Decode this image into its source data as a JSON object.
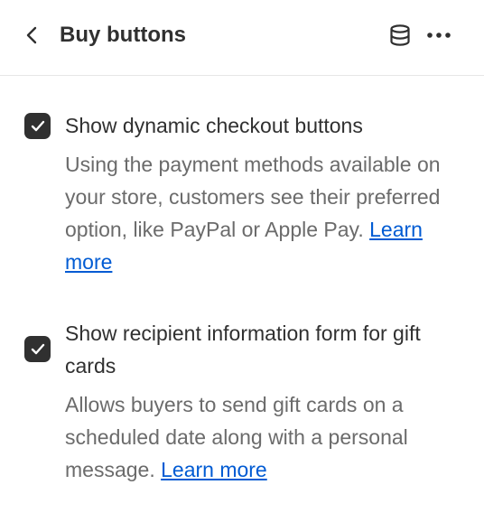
{
  "header": {
    "title": "Buy buttons",
    "back_icon": "chevron-left-icon",
    "database_icon": "database-icon",
    "more_icon": "ellipsis-horizontal-icon"
  },
  "settings": [
    {
      "checked": true,
      "label": "Show dynamic checkout buttons",
      "description": "Using the payment methods available on your store, customers see their preferred option, like PayPal or Apple Pay.",
      "link": "Learn more"
    },
    {
      "checked": true,
      "label": "Show recipient information form for gift cards",
      "description": "Allows buyers to send gift cards on a scheduled date along with a personal message.",
      "link": "Learn more"
    }
  ],
  "colors": {
    "text": "#303030",
    "muted": "#6b6b6b",
    "link": "#005bd3",
    "checkbox": "#303030"
  }
}
